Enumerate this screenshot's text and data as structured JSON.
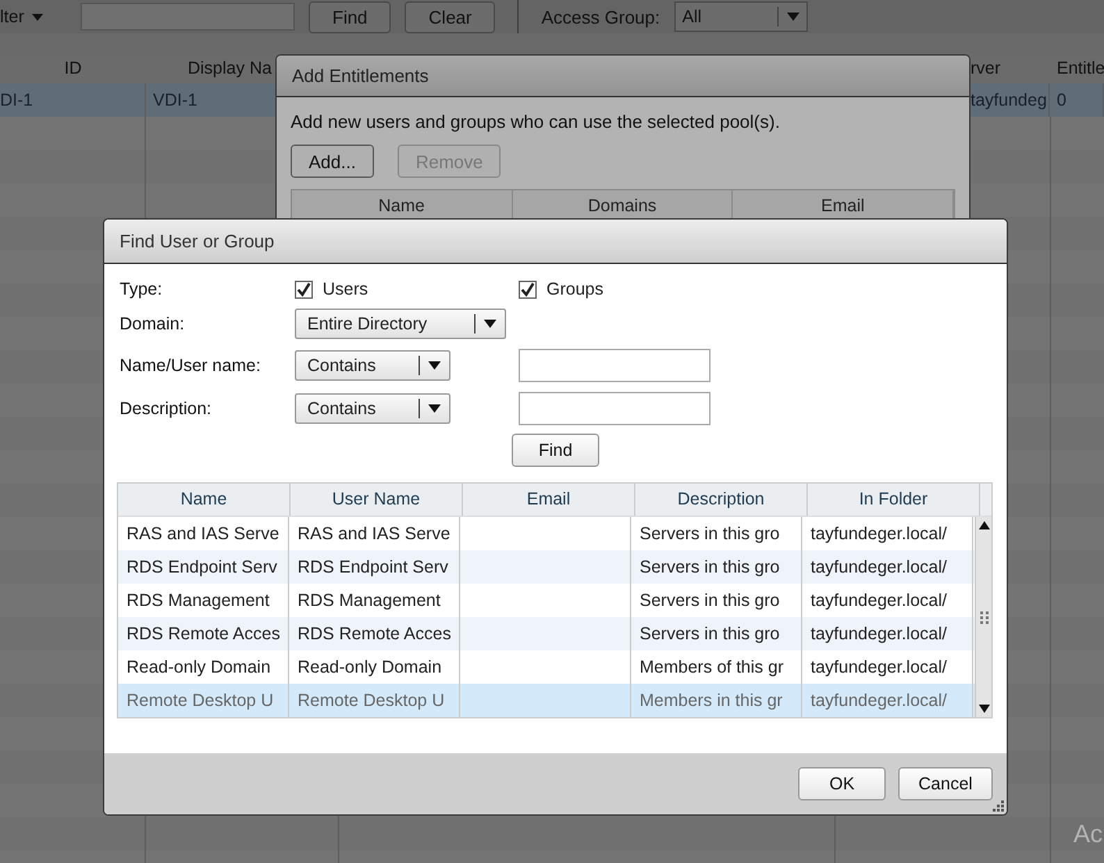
{
  "toolbar": {
    "filter_label": "lter",
    "find_button": "Find",
    "clear_button": "Clear",
    "access_group_label": "Access Group:",
    "access_group_value": "All"
  },
  "pools_table": {
    "columns": [
      "ID",
      "Display Na",
      "rver",
      "Entitle"
    ],
    "rows": [
      {
        "id": "DI-1",
        "display_name": "VDI-1",
        "server": "tayfundeg",
        "entitlements": "0",
        "selected": true
      }
    ]
  },
  "add_entitlements": {
    "title": "Add Entitlements",
    "description": "Add new users and groups who can use the selected pool(s).",
    "add_button": {
      "label": "Add...",
      "disabled": false
    },
    "remove_button": {
      "label": "Remove",
      "disabled": true
    },
    "columns": [
      "Name",
      "Domains",
      "Email"
    ]
  },
  "find_dialog": {
    "title": "Find User or Group",
    "type_label": "Type:",
    "types": [
      {
        "label": "Users",
        "checked": true
      },
      {
        "label": "Groups",
        "checked": true
      }
    ],
    "domain_label": "Domain:",
    "domain_value": "Entire Directory",
    "name_label": "Name/User name:",
    "name_match": "Contains",
    "description_label": "Description:",
    "description_match": "Contains",
    "find_button": "Find",
    "columns": [
      "Name",
      "User Name",
      "Email",
      "Description",
      "In Folder"
    ],
    "rows": [
      {
        "cells": [
          "RAS and IAS Serve",
          "RAS and IAS Serve",
          "",
          "Servers in this gro",
          "tayfundeger.local/"
        ],
        "selected": false
      },
      {
        "cells": [
          "RDS Endpoint Serv",
          "RDS Endpoint Serv",
          "",
          "Servers in this gro",
          "tayfundeger.local/"
        ],
        "selected": false
      },
      {
        "cells": [
          "RDS Management",
          "RDS Management",
          "",
          "Servers in this gro",
          "tayfundeger.local/"
        ],
        "selected": false
      },
      {
        "cells": [
          "RDS Remote Acces",
          "RDS Remote Acces",
          "",
          "Servers in this gro",
          "tayfundeger.local/"
        ],
        "selected": false
      },
      {
        "cells": [
          "Read-only Domain",
          "Read-only Domain",
          "",
          "Members of this gr",
          "tayfundeger.local/"
        ],
        "selected": false
      },
      {
        "cells": [
          "Remote Desktop U",
          "Remote Desktop U",
          "",
          "Members in this gr",
          "tayfundeger.local/"
        ],
        "selected": true
      }
    ],
    "ok_button": "OK",
    "cancel_button": "Cancel"
  },
  "activation_notice": "Ac"
}
